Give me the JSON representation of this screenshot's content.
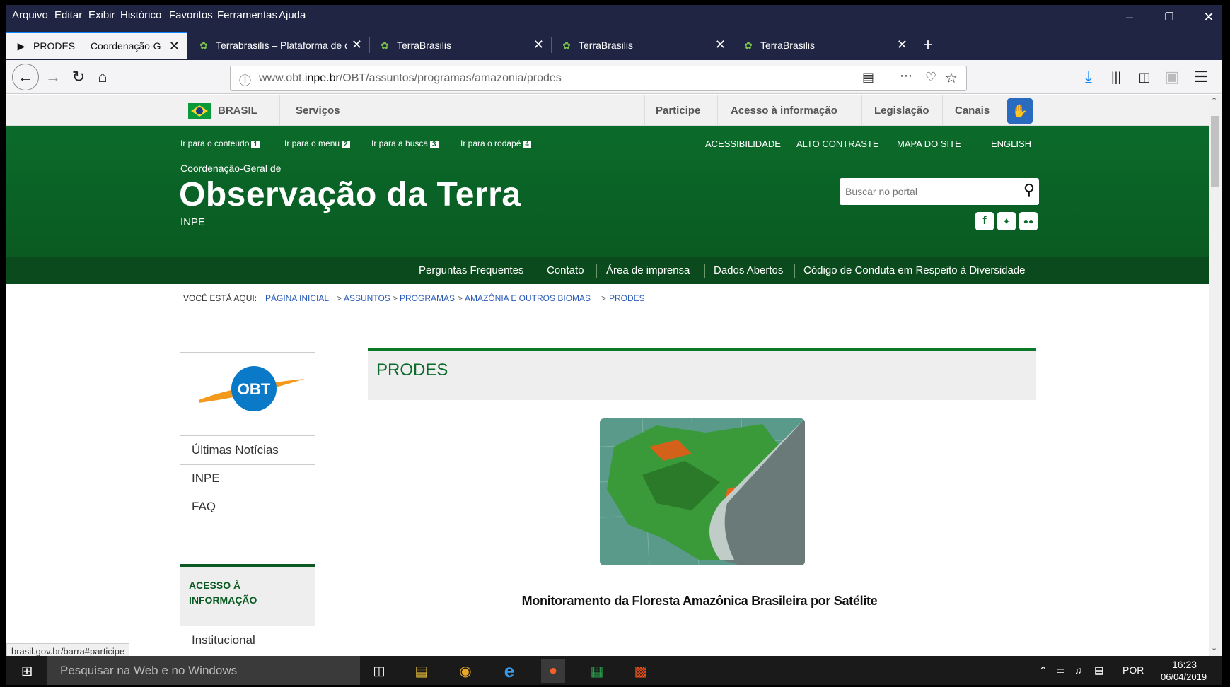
{
  "menu": [
    "Arquivo",
    "Editar",
    "Exibir",
    "Histórico",
    "Favoritos",
    "Ferramentas",
    "Ajuda"
  ],
  "tabs": [
    {
      "label": "PRODES — Coordenação-Geral de Observação da Terra",
      "active": true
    },
    {
      "label": "Terrabrasilis – Plataforma de dados",
      "active": false
    },
    {
      "label": "TerraBrasilis",
      "active": false
    },
    {
      "label": "TerraBrasilis",
      "active": false
    },
    {
      "label": "TerraBrasilis",
      "active": false
    }
  ],
  "url": {
    "host_pre": "www.obt.",
    "host": "inpe.br",
    "path": "/OBT/assuntos/programas/amazonia/prodes"
  },
  "gov": {
    "brasil": "BRASIL",
    "servicos": "Serviços",
    "participe": "Participe",
    "acesso": "Acesso à informação",
    "legislacao": "Legislação",
    "canais": "Canais"
  },
  "skip": [
    {
      "label": "Ir para o conteúdo",
      "key": "1"
    },
    {
      "label": "Ir para o menu",
      "key": "2"
    },
    {
      "label": "Ir para a busca",
      "key": "3"
    },
    {
      "label": "Ir para o rodapé",
      "key": "4"
    }
  ],
  "top_links": [
    "ACESSIBILIDADE",
    "ALTO CONTRASTE",
    "MAPA DO SITE",
    "ENGLISH"
  ],
  "header": {
    "pre": "Coordenação-Geral de",
    "title": "Observação da Terra",
    "sub": "INPE"
  },
  "search": {
    "placeholder": "Buscar no portal"
  },
  "subnav": [
    "Perguntas Frequentes",
    "Contato",
    "Área de imprensa",
    "Dados Abertos",
    "Código de Conduta em Respeito à Diversidade"
  ],
  "breadcrumb": {
    "label": "VOCÊ ESTÁ AQUI:",
    "items": [
      "PÁGINA INICIAL",
      "ASSUNTOS",
      "PROGRAMAS",
      "AMAZÔNIA E OUTROS BIOMAS",
      "PRODES"
    ]
  },
  "logo": "OBT",
  "sidebar": [
    "Últimas Notícias",
    "INPE",
    "FAQ"
  ],
  "acesso_title": "ACESSO À INFORMAÇÃO",
  "institucional": "Institucional",
  "page_title": "PRODES",
  "caption": "Monitoramento da Floresta Amazônica Brasileira por Satélite",
  "status_url": "brasil.gov.br/barra#participe",
  "taskbar": {
    "search": "Pesquisar na Web e no Windows",
    "lang": "POR",
    "time": "16:23",
    "date": "06/04/2019"
  },
  "colors": {
    "header_green": "#0b6b2a",
    "subnav_green": "#0a4a1c",
    "chrome": "#1f2542"
  }
}
